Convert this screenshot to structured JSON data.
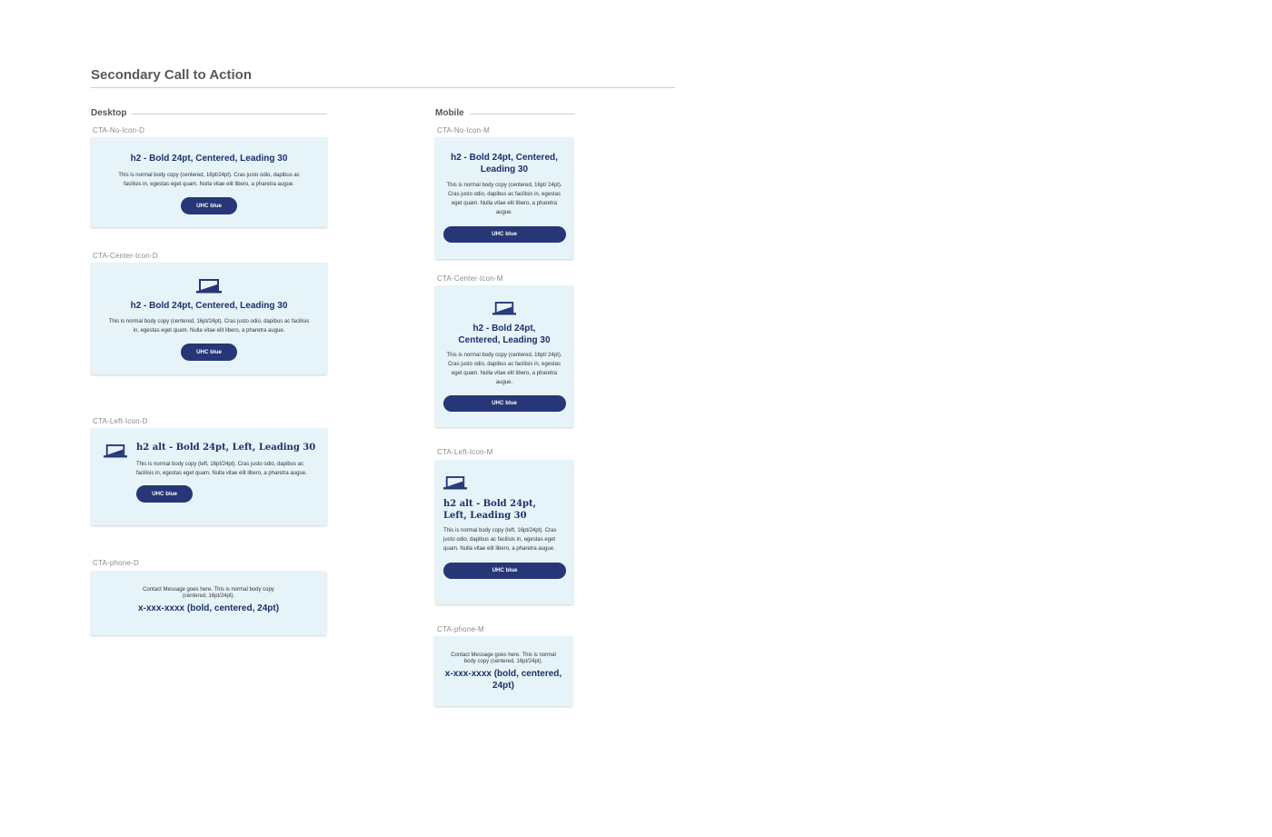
{
  "page": {
    "title": "Secondary Call to Action"
  },
  "columns": {
    "desktop": "Desktop",
    "mobile": "Mobile"
  },
  "icons": {
    "laptop": "laptop-icon",
    "accent": "#263676",
    "card_bg": "#e6f4f9"
  },
  "desktop": {
    "no_icon": {
      "label": "CTA-No-Icon-D",
      "heading": "h2 - Bold 24pt, Centered, Leading 30",
      "body": "This is normal body copy (centered, 16pt/24pt). Cras justo odio, dapibus ac facilisis in, egestas eget quam. Nulla vitae elit libero, a pharetra augue.",
      "button": "UHC blue"
    },
    "center_icon": {
      "label": "CTA-Center-Icon-D",
      "heading": "h2 - Bold 24pt, Centered, Leading 30",
      "body": "This is normal body copy (centered, 16pt/24pt). Cras justo odio, dapibus ac facilisis in, egestas eget quam. Nulla vitae elit libero, a pharetra augue.",
      "button": "UHC blue"
    },
    "left_icon": {
      "label": "CTA-Left-Icon-D",
      "heading": "h2 alt - Bold 24pt, Left, Leading 30",
      "body": "This is normal body copy (left, 16pt/24pt). Cras justo odio, dapibus ac facilisis in, egestas eget quam. Nulla vitae elit libero, a pharetra augue.",
      "button": "UHC blue"
    },
    "phone": {
      "label": "CTA-phone-D",
      "message": "Contact Message goes here. This is normal body copy (centered, 16pt/24pt).",
      "number": "x-xxx-xxxx (bold, centered, 24pt)"
    }
  },
  "mobile": {
    "no_icon": {
      "label": "CTA-No-Icon-M",
      "heading": "h2 - Bold 24pt, Centered, Leading 30",
      "body": "This is normal body copy (centered, 16pt/ 24pt). Cras justo odio, dapibus ac facilisis in, egestas eget quam. Nulla vitae elit libero, a pharetra augue.",
      "button": "UHC blue"
    },
    "center_icon": {
      "label": "CTA-Center-Icon-M",
      "heading": "h2 - Bold 24pt, Centered, Leading 30",
      "body": "This is normal body copy (centered, 16pt/ 24pt). Cras justo odio, dapibus ac facilisis in, egestas eget quam. Nulla vitae elit libero, a pharetra augue.",
      "button": "UHC blue"
    },
    "left_icon": {
      "label": "CTA-Left-Icon-M",
      "heading": "h2 alt - Bold 24pt, Left, Leading 30",
      "body": "This is normal body copy (left, 16pt/24pt). Cras justo odio, dapibus ac facilisis in, egestas eget quam. Nulla vitae elit libero, a pharetra augue.",
      "button": "UHC blue"
    },
    "phone": {
      "label": "CTA-phone-M",
      "message": "Contact Message goes here. This is normal body copy (centered, 16pt/24pt).",
      "number": "x-xxx-xxxx (bold, centered, 24pt)"
    }
  }
}
